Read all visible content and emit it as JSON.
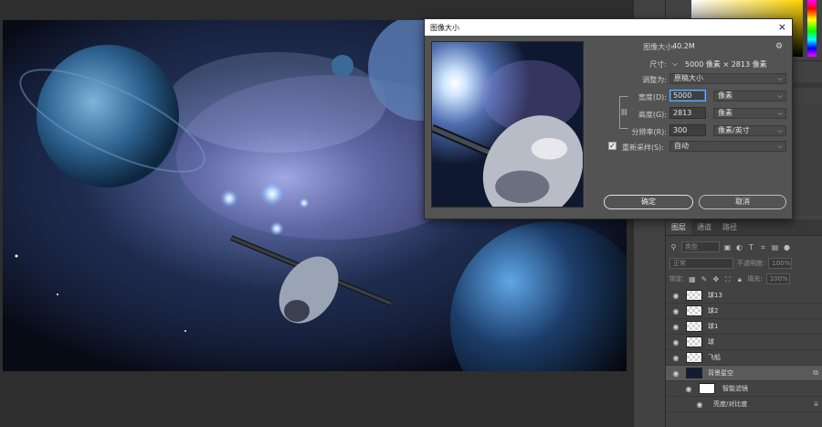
{
  "dialog": {
    "title": "图像大小",
    "close_glyph": "×",
    "image_size_label": "图像大小:",
    "image_size_value": "40.2M",
    "dimensions_label": "尺寸:",
    "dimensions_value": "5000 像素 × 2813 像素",
    "fit_to_label": "调整为:",
    "fit_to_value": "原稿大小",
    "width_label": "宽度(D):",
    "width_value": "5000",
    "width_unit": "像素",
    "height_label": "高度(G):",
    "height_value": "2813",
    "height_unit": "像素",
    "resolution_label": "分辨率(R):",
    "resolution_value": "300",
    "resolution_unit": "像素/英寸",
    "resample_label": "重新采样(S):",
    "resample_value": "自动",
    "resample_checked": true,
    "ok_label": "确定",
    "cancel_label": "取消"
  },
  "layers_panel": {
    "tabs": [
      "图层",
      "通道",
      "路径"
    ],
    "filter_kind": "类型",
    "blend_mode": "正常",
    "opacity_label": "不透明度:",
    "opacity_value": "100%",
    "lock_label": "锁定:",
    "fill_label": "填充:",
    "fill_value": "100%",
    "layers": [
      {
        "name": "球13"
      },
      {
        "name": "球2"
      },
      {
        "name": "球1"
      },
      {
        "name": "球"
      },
      {
        "name": "飞船"
      },
      {
        "name": "背景星空"
      },
      {
        "name": "智能滤镜"
      },
      {
        "name": "亮度/对比度"
      }
    ]
  },
  "colors": {
    "accent_focus": "#68a8ff",
    "panel_bg": "#424242",
    "dialog_bg": "#535353",
    "selected_layer": "#5a5a5a"
  },
  "icons": {
    "eye": "eye-icon",
    "gear": "gear-icon",
    "link": "link-icon",
    "chevron": "chevron-down-icon"
  }
}
